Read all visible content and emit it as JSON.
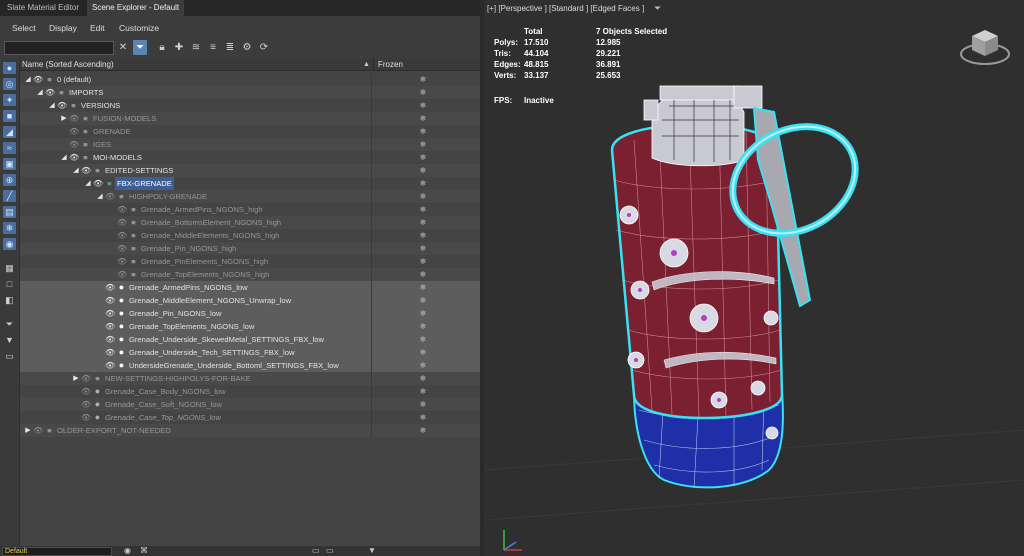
{
  "tabs": [
    "Slate Material Editor",
    "Scene Explorer - Default"
  ],
  "menu": [
    "Select",
    "Display",
    "Edit",
    "Customize"
  ],
  "toolbar_icons": [
    "close-icon",
    "filter-icon",
    "lock-icon",
    "add-layer-icon",
    "layers-icon",
    "layers-stack-icon",
    "layers-alt-icon",
    "settings-layer-icon",
    "sync-icon"
  ],
  "columns": {
    "name": "Name (Sorted Ascending)",
    "sort_indicator": "▲",
    "frozen": "Frozen"
  },
  "tree": [
    {
      "label": "0 (default)",
      "indent": 0,
      "arrow": "open",
      "eye": true,
      "icon": "layer",
      "style": "norm"
    },
    {
      "label": "IMPORTS",
      "indent": 1,
      "arrow": "open",
      "eye": true,
      "icon": "layer",
      "style": "norm"
    },
    {
      "label": "VERSIONS",
      "indent": 2,
      "arrow": "open",
      "eye": true,
      "icon": "layer",
      "style": "norm"
    },
    {
      "label": "FUSION-MODELS",
      "indent": 3,
      "arrow": "closed",
      "eye": false,
      "icon": "layer",
      "style": "dim"
    },
    {
      "label": "GRENADE",
      "indent": 3,
      "arrow": "",
      "eye": false,
      "icon": "layer",
      "style": "dim"
    },
    {
      "label": "IGES",
      "indent": 3,
      "arrow": "",
      "eye": false,
      "icon": "layer",
      "style": "dim"
    },
    {
      "label": "MOI-MODELS",
      "indent": 3,
      "arrow": "open",
      "eye": true,
      "icon": "layer",
      "style": "norm"
    },
    {
      "label": "EDITED-SETTINGS",
      "indent": 4,
      "arrow": "open",
      "eye": true,
      "icon": "layer",
      "style": "norm"
    },
    {
      "label": "FBX-GRENADE",
      "indent": 5,
      "arrow": "open",
      "eye": true,
      "icon": "layer-hl",
      "style": "hl"
    },
    {
      "label": "HIGHPOLY-GRENADE",
      "indent": 6,
      "arrow": "open",
      "eye": false,
      "icon": "layer",
      "style": "dim"
    },
    {
      "label": "Grenade_ArmedPins_NGONS_high",
      "indent": 7,
      "arrow": "",
      "eye": false,
      "icon": "layer",
      "style": "dim"
    },
    {
      "label": "Grenade_BottomsElement_NGONS_high",
      "indent": 7,
      "arrow": "",
      "eye": false,
      "icon": "layer",
      "style": "dim"
    },
    {
      "label": "Grenade_MiddleElements_NGONS_high",
      "indent": 7,
      "arrow": "",
      "eye": false,
      "icon": "layer",
      "style": "dim"
    },
    {
      "label": "Grenade_Pin_NGONS_high",
      "indent": 7,
      "arrow": "",
      "eye": false,
      "icon": "layer",
      "style": "dim"
    },
    {
      "label": "Grenade_PinElements_NGONS_high",
      "indent": 7,
      "arrow": "",
      "eye": false,
      "icon": "layer",
      "style": "dim"
    },
    {
      "label": "Grenade_TopElements_NGONS_high",
      "indent": 7,
      "arrow": "",
      "eye": false,
      "icon": "layer",
      "style": "dim"
    },
    {
      "label": "Grenade_ArmedPins_NGONS_low",
      "indent": 6,
      "arrow": "",
      "eye": true,
      "icon": "dot",
      "style": "sel"
    },
    {
      "label": "Grenade_MiddleElement_NGONS_Unwrap_low",
      "indent": 6,
      "arrow": "",
      "eye": true,
      "icon": "dot",
      "style": "sel"
    },
    {
      "label": "Grenade_Pin_NGONS_low",
      "indent": 6,
      "arrow": "",
      "eye": true,
      "icon": "dot",
      "style": "sel"
    },
    {
      "label": "Grenade_TopElements_NGONS_low",
      "indent": 6,
      "arrow": "",
      "eye": true,
      "icon": "dot",
      "style": "sel"
    },
    {
      "label": "Grenade_Underside_SkewedMetal_SETTINGS_FBX_low",
      "indent": 6,
      "arrow": "",
      "eye": true,
      "icon": "dot",
      "style": "sel"
    },
    {
      "label": "Grenade_Underside_Tech_SETTINGS_FBX_low",
      "indent": 6,
      "arrow": "",
      "eye": true,
      "icon": "dot",
      "style": "sel"
    },
    {
      "label": "UndersideGrenade_Underside_Bottoml_SETTINGS_FBX_low",
      "indent": 6,
      "arrow": "",
      "eye": true,
      "icon": "dot",
      "style": "sel"
    },
    {
      "label": "NEW-SETTINGS-HIGHPOLYS-FOR-BAKE",
      "indent": 4,
      "arrow": "closed",
      "eye": false,
      "icon": "layer",
      "style": "dim"
    },
    {
      "label": "Grenade_Case_Body_NGONS_low",
      "indent": 4,
      "arrow": "",
      "eye": false,
      "icon": "dot-off",
      "style": "dim"
    },
    {
      "label": "Grenade_Case_Soft_NGONS_low",
      "indent": 4,
      "arrow": "",
      "eye": false,
      "icon": "dot-off",
      "style": "dim"
    },
    {
      "label": "Grenade_Case_Top_NGONS_low",
      "indent": 4,
      "arrow": "",
      "eye": false,
      "icon": "dot-off",
      "style": "it"
    },
    {
      "label": "OLDER-EXPORT_NOT-NEEDED",
      "indent": 0,
      "arrow": "closed",
      "eye": false,
      "icon": "layer",
      "style": "dim"
    }
  ],
  "status": {
    "input_value": "Default"
  },
  "viewport": {
    "label": "[+] [Perspective ] [Standard ] [Edged Faces ]",
    "stats": {
      "col_total": "Total",
      "col_selected": "7 Objects Selected",
      "rows": [
        {
          "label": "Polys:",
          "total": "17.510",
          "selected": "12.985"
        },
        {
          "label": "Tris:",
          "total": "44.104",
          "selected": "29.221"
        },
        {
          "label": "Edges:",
          "total": "48.815",
          "selected": "36.891"
        },
        {
          "label": "Verts:",
          "total": "33.137",
          "selected": "25.653"
        }
      ],
      "fps_label": "FPS:",
      "fps_value": "Inactive"
    }
  },
  "colors": {
    "body_red": "#7a2030",
    "bottom_blue": "#1e2fa8",
    "wire_cyan": "#39e2f2",
    "selection_blue": "#3d5f93"
  }
}
